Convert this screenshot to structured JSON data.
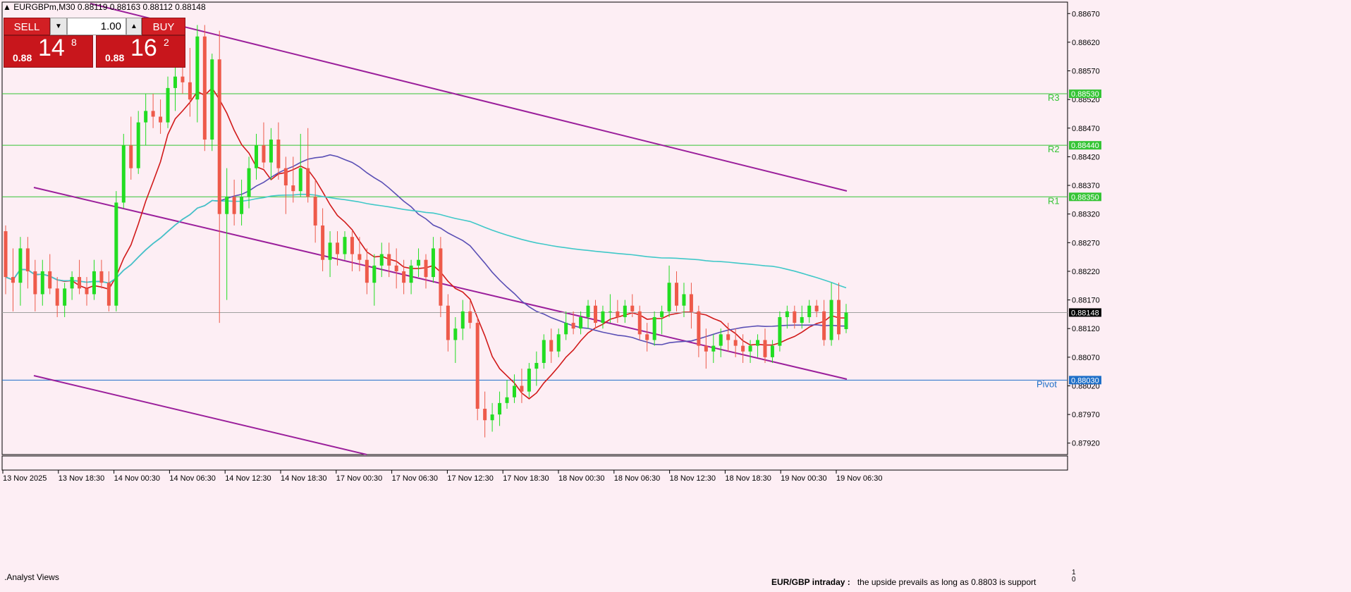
{
  "window": {
    "title": "EURGBPm,M30  0.88119 0.88163 0.88112 0.88148"
  },
  "trade_panel": {
    "sell_label": "SELL",
    "buy_label": "BUY",
    "lot_value": "1.00",
    "sell_price": {
      "prefix": "0.88",
      "big": "14",
      "fraction": "8"
    },
    "buy_price": {
      "prefix": "0.88",
      "big": "16",
      "fraction": "2"
    }
  },
  "price_axis": {
    "ticks": [
      "0.88670",
      "0.88620",
      "0.88570",
      "0.88520",
      "0.88470",
      "0.88420",
      "0.88370",
      "0.88320",
      "0.88270",
      "0.88220",
      "0.88170",
      "0.88120",
      "0.88070",
      "0.88020",
      "0.87970",
      "0.87920"
    ],
    "current_price": "0.88148"
  },
  "levels": [
    {
      "name": "R3",
      "price": 0.8853,
      "label": "0.88530",
      "color": "#35c435"
    },
    {
      "name": "R2",
      "price": 0.8844,
      "label": "0.88440",
      "color": "#35c435"
    },
    {
      "name": "R1",
      "price": 0.8835,
      "label": "0.88350",
      "color": "#35c435"
    },
    {
      "name": "Pivot",
      "price": 0.8803,
      "label": "0.88030",
      "color": "#1e6fc8"
    }
  ],
  "time_axis": {
    "labels": [
      "13 Nov 2025",
      "13 Nov 18:30",
      "14 Nov 00:30",
      "14 Nov 06:30",
      "14 Nov 12:30",
      "14 Nov 18:30",
      "17 Nov 00:30",
      "17 Nov 06:30",
      "17 Nov 12:30",
      "17 Nov 18:30",
      "18 Nov 00:30",
      "18 Nov 06:30",
      "18 Nov 12:30",
      "18 Nov 18:30",
      "19 Nov 00:30",
      "19 Nov 06:30"
    ]
  },
  "indicator_panel": {
    "label": ".Analyst Views",
    "scale_top": "1",
    "scale_bottom": "0",
    "news_title": "EUR/GBP intraday :",
    "news_body": "the upside prevails as long as 0.8803 is support"
  },
  "colors": {
    "background": "#fdeef4",
    "bull_candle": "#22dd22",
    "bear_candle": "#ee5a4a",
    "ma_fast": "#d11a1a",
    "ma_mid": "#5a4fb5",
    "ma_slow": "#40c8c8",
    "channel": "#9b1f9b"
  },
  "chart_data": {
    "type": "candlestick",
    "symbol": "EURGBPm",
    "timeframe": "M30",
    "ylim": [
      0.879,
      0.8869
    ],
    "open": 0.88119,
    "high": 0.88163,
    "low": 0.88112,
    "close": 0.88148,
    "candles": [
      [
        0.8829,
        0.883,
        0.8818,
        0.8821
      ],
      [
        0.8821,
        0.8826,
        0.8815,
        0.882
      ],
      [
        0.882,
        0.8828,
        0.8816,
        0.8826
      ],
      [
        0.8826,
        0.8828,
        0.8819,
        0.8822
      ],
      [
        0.8822,
        0.8824,
        0.8815,
        0.8818
      ],
      [
        0.8818,
        0.8824,
        0.8816,
        0.8822
      ],
      [
        0.8822,
        0.8825,
        0.8818,
        0.8819
      ],
      [
        0.8819,
        0.8821,
        0.8814,
        0.8816
      ],
      [
        0.8816,
        0.882,
        0.8814,
        0.8819
      ],
      [
        0.8819,
        0.8822,
        0.8817,
        0.8821
      ],
      [
        0.8821,
        0.8824,
        0.8818,
        0.8819
      ],
      [
        0.8819,
        0.8821,
        0.8816,
        0.8818
      ],
      [
        0.8818,
        0.8824,
        0.8817,
        0.8822
      ],
      [
        0.8822,
        0.8824,
        0.8819,
        0.882
      ],
      [
        0.882,
        0.8822,
        0.8815,
        0.8816
      ],
      [
        0.8816,
        0.8836,
        0.8815,
        0.8834
      ],
      [
        0.8834,
        0.8846,
        0.8833,
        0.8844
      ],
      [
        0.8844,
        0.8849,
        0.8838,
        0.884
      ],
      [
        0.884,
        0.885,
        0.8839,
        0.8848
      ],
      [
        0.8848,
        0.8853,
        0.8844,
        0.885
      ],
      [
        0.885,
        0.8853,
        0.8847,
        0.8849
      ],
      [
        0.8849,
        0.8852,
        0.8846,
        0.8848
      ],
      [
        0.8848,
        0.8856,
        0.8847,
        0.8854
      ],
      [
        0.8854,
        0.8859,
        0.885,
        0.8856
      ],
      [
        0.8856,
        0.8859,
        0.8853,
        0.8855
      ],
      [
        0.8855,
        0.8861,
        0.8849,
        0.8852
      ],
      [
        0.8852,
        0.8865,
        0.8848,
        0.8863
      ],
      [
        0.8863,
        0.8865,
        0.8843,
        0.8845
      ],
      [
        0.8845,
        0.886,
        0.8843,
        0.8859
      ],
      [
        0.8859,
        0.8864,
        0.8813,
        0.8832
      ],
      [
        0.8832,
        0.884,
        0.8817,
        0.8835
      ],
      [
        0.8835,
        0.8838,
        0.883,
        0.8832
      ],
      [
        0.8832,
        0.8838,
        0.883,
        0.8835
      ],
      [
        0.8835,
        0.8842,
        0.8833,
        0.884
      ],
      [
        0.884,
        0.8846,
        0.8838,
        0.8844
      ],
      [
        0.8844,
        0.8848,
        0.884,
        0.8841
      ],
      [
        0.8841,
        0.8847,
        0.8838,
        0.8845
      ],
      [
        0.8845,
        0.8848,
        0.8838,
        0.884
      ],
      [
        0.884,
        0.8842,
        0.8832,
        0.8837
      ],
      [
        0.8837,
        0.8842,
        0.8834,
        0.8836
      ],
      [
        0.8836,
        0.8846,
        0.8835,
        0.884
      ],
      [
        0.884,
        0.8847,
        0.8834,
        0.8835
      ],
      [
        0.8835,
        0.8838,
        0.8827,
        0.883
      ],
      [
        0.883,
        0.8833,
        0.8822,
        0.8824
      ],
      [
        0.8824,
        0.8829,
        0.8821,
        0.8827
      ],
      [
        0.8827,
        0.8829,
        0.8823,
        0.8825
      ],
      [
        0.8825,
        0.8829,
        0.8824,
        0.8828
      ],
      [
        0.8828,
        0.8829,
        0.8822,
        0.8825
      ],
      [
        0.8825,
        0.8828,
        0.8822,
        0.8824
      ],
      [
        0.8824,
        0.8826,
        0.8818,
        0.882
      ],
      [
        0.882,
        0.8825,
        0.8816,
        0.8823
      ],
      [
        0.8823,
        0.8827,
        0.8821,
        0.8825
      ],
      [
        0.8825,
        0.8827,
        0.8821,
        0.8823
      ],
      [
        0.8823,
        0.8826,
        0.8819,
        0.8822
      ],
      [
        0.8822,
        0.8824,
        0.8818,
        0.882
      ],
      [
        0.882,
        0.8824,
        0.8818,
        0.8823
      ],
      [
        0.8823,
        0.8826,
        0.8821,
        0.8824
      ],
      [
        0.8824,
        0.8825,
        0.8819,
        0.8821
      ],
      [
        0.8821,
        0.8828,
        0.882,
        0.8826
      ],
      [
        0.8826,
        0.8828,
        0.8814,
        0.8816
      ],
      [
        0.8816,
        0.8818,
        0.8808,
        0.881
      ],
      [
        0.881,
        0.8814,
        0.8806,
        0.8812
      ],
      [
        0.8812,
        0.8817,
        0.881,
        0.8815
      ],
      [
        0.8815,
        0.8817,
        0.8812,
        0.8813
      ],
      [
        0.8813,
        0.8814,
        0.8796,
        0.8798
      ],
      [
        0.8798,
        0.8801,
        0.8793,
        0.8796
      ],
      [
        0.8796,
        0.8799,
        0.8794,
        0.8797
      ],
      [
        0.8797,
        0.8801,
        0.8795,
        0.8799
      ],
      [
        0.8799,
        0.8803,
        0.8798,
        0.88
      ],
      [
        0.88,
        0.8804,
        0.8799,
        0.8802
      ],
      [
        0.8802,
        0.8805,
        0.8799,
        0.8801
      ],
      [
        0.8801,
        0.8806,
        0.88,
        0.8805
      ],
      [
        0.8805,
        0.8808,
        0.8802,
        0.8806
      ],
      [
        0.8806,
        0.8811,
        0.8805,
        0.881
      ],
      [
        0.881,
        0.8812,
        0.8806,
        0.8808
      ],
      [
        0.8808,
        0.8812,
        0.8807,
        0.8811
      ],
      [
        0.8811,
        0.8815,
        0.881,
        0.8813
      ],
      [
        0.8813,
        0.8815,
        0.8811,
        0.8812
      ],
      [
        0.8812,
        0.8815,
        0.8811,
        0.8814
      ],
      [
        0.8814,
        0.8817,
        0.8812,
        0.8816
      ],
      [
        0.8816,
        0.8817,
        0.8812,
        0.8813
      ],
      [
        0.8813,
        0.8816,
        0.8812,
        0.8815
      ],
      [
        0.8815,
        0.8818,
        0.8813,
        0.8815
      ],
      [
        0.8815,
        0.8817,
        0.8813,
        0.8814
      ],
      [
        0.8814,
        0.8817,
        0.8813,
        0.8816
      ],
      [
        0.8816,
        0.8818,
        0.8814,
        0.8815
      ],
      [
        0.8815,
        0.8816,
        0.881,
        0.8811
      ],
      [
        0.8811,
        0.8813,
        0.8808,
        0.881
      ],
      [
        0.881,
        0.8815,
        0.8809,
        0.8814
      ],
      [
        0.8814,
        0.8816,
        0.8811,
        0.8815
      ],
      [
        0.8815,
        0.8823,
        0.8814,
        0.882
      ],
      [
        0.882,
        0.8822,
        0.8815,
        0.8816
      ],
      [
        0.8816,
        0.882,
        0.8814,
        0.8818
      ],
      [
        0.8818,
        0.882,
        0.8812,
        0.8815
      ],
      [
        0.8815,
        0.8816,
        0.8807,
        0.8809
      ],
      [
        0.8809,
        0.8812,
        0.8805,
        0.8808
      ],
      [
        0.8808,
        0.8811,
        0.8806,
        0.8809
      ],
      [
        0.8809,
        0.8812,
        0.8807,
        0.8811
      ],
      [
        0.8811,
        0.8813,
        0.8808,
        0.881
      ],
      [
        0.881,
        0.8812,
        0.8807,
        0.8809
      ],
      [
        0.8809,
        0.8811,
        0.8806,
        0.8808
      ],
      [
        0.8808,
        0.881,
        0.8806,
        0.8809
      ],
      [
        0.8809,
        0.8811,
        0.8807,
        0.881
      ],
      [
        0.881,
        0.8812,
        0.8806,
        0.8807
      ],
      [
        0.8807,
        0.881,
        0.8806,
        0.8809
      ],
      [
        0.8809,
        0.8815,
        0.8808,
        0.8814
      ],
      [
        0.8814,
        0.8816,
        0.8812,
        0.8815
      ],
      [
        0.8815,
        0.8816,
        0.8812,
        0.8813
      ],
      [
        0.8813,
        0.8816,
        0.8812,
        0.8814
      ],
      [
        0.8814,
        0.8817,
        0.8813,
        0.8816
      ],
      [
        0.8816,
        0.8817,
        0.8814,
        0.8815
      ],
      [
        0.8815,
        0.8817,
        0.8809,
        0.881
      ],
      [
        0.881,
        0.882,
        0.8809,
        0.8817
      ],
      [
        0.8817,
        0.882,
        0.881,
        0.8811
      ],
      [
        0.88119,
        0.88163,
        0.88112,
        0.88148
      ]
    ]
  }
}
